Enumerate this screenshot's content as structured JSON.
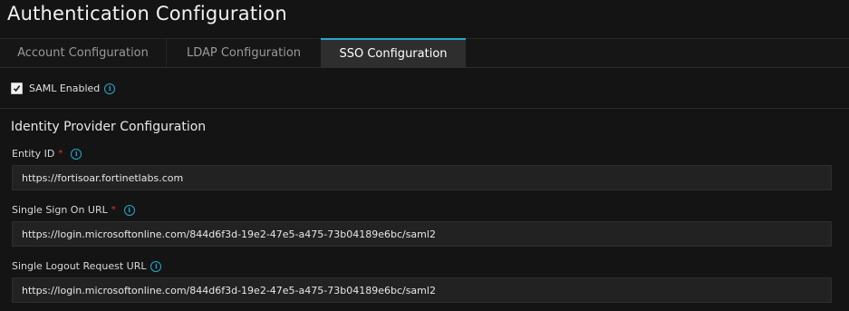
{
  "page_title": "Authentication Configuration",
  "tabs": [
    {
      "label": "Account Configuration",
      "active": false
    },
    {
      "label": "LDAP Configuration",
      "active": false
    },
    {
      "label": "SSO Configuration",
      "active": true
    }
  ],
  "saml": {
    "label": "SAML Enabled",
    "checked": true,
    "info_icon": "info-icon"
  },
  "identity_provider": {
    "title": "Identity Provider Configuration",
    "fields": [
      {
        "label": "Entity ID",
        "required": true,
        "required_mark": "*",
        "value": "https://fortisoar.fortinetlabs.com"
      },
      {
        "label": "Single Sign On URL",
        "required": true,
        "required_mark": "*",
        "value": "https://login.microsoftonline.com/844d6f3d-19e2-47e5-a475-73b04189e6bc/saml2"
      },
      {
        "label": "Single Logout Request URL",
        "required": false,
        "value": "https://login.microsoftonline.com/844d6f3d-19e2-47e5-a475-73b04189e6bc/saml2"
      }
    ]
  },
  "colors": {
    "accent": "#2aa7c9",
    "required": "#d43b3b",
    "background": "#141414"
  }
}
